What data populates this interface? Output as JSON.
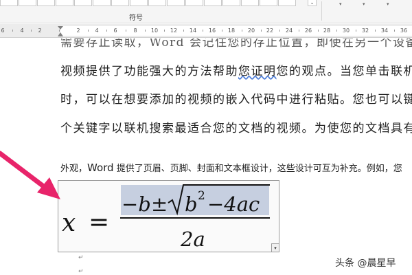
{
  "ribbon": {
    "group_label": "符号",
    "scroll_arrow": "⌄",
    "carets": [
      "▾",
      "▾",
      "▾"
    ]
  },
  "ruler": {
    "labels": [
      "6",
      "4",
      "2",
      "2",
      "4",
      "6",
      "8",
      "10",
      "12",
      "14",
      "16",
      "18",
      "20",
      "22",
      "24",
      "26",
      "28",
      "30",
      "32",
      "34",
      "36"
    ]
  },
  "document": {
    "line_cut": "需要存止读取，Word 会记住您的存止位置，即使在另一个设备",
    "line1_a": "视频提供了功能强大的方法帮助",
    "line1_underlined": "您证明",
    "line1_b": "您的观点。当您单击联机视",
    "line2": "时，可以在想要添加的视频的嵌入代码中进行粘贴。您也可以键入",
    "line3": "个关键字以联机搜索最适合您的文档的视频。为使您的文档具有专",
    "line4_a": "外观，",
    "line4_word": "Word",
    "line4_b": " 提供了页眉、页脚、封面和文本框设计，这些设计可互为补充。例如，您",
    "para_mark": "↵",
    "eq_scroll": "▾"
  },
  "equation": {
    "lhs": "x",
    "eq": "=",
    "numerator_neg": "−b",
    "pm": "±",
    "sqrt_b": "b",
    "sqrt_exp": "2",
    "sqrt_rest": "−4ac",
    "denominator": "2a"
  },
  "watermark": "头条 @晨星早",
  "colors": {
    "arrow": "#e8246a",
    "highlight": "#c6cfe0",
    "wavy_underline": "#4a7bd8"
  }
}
